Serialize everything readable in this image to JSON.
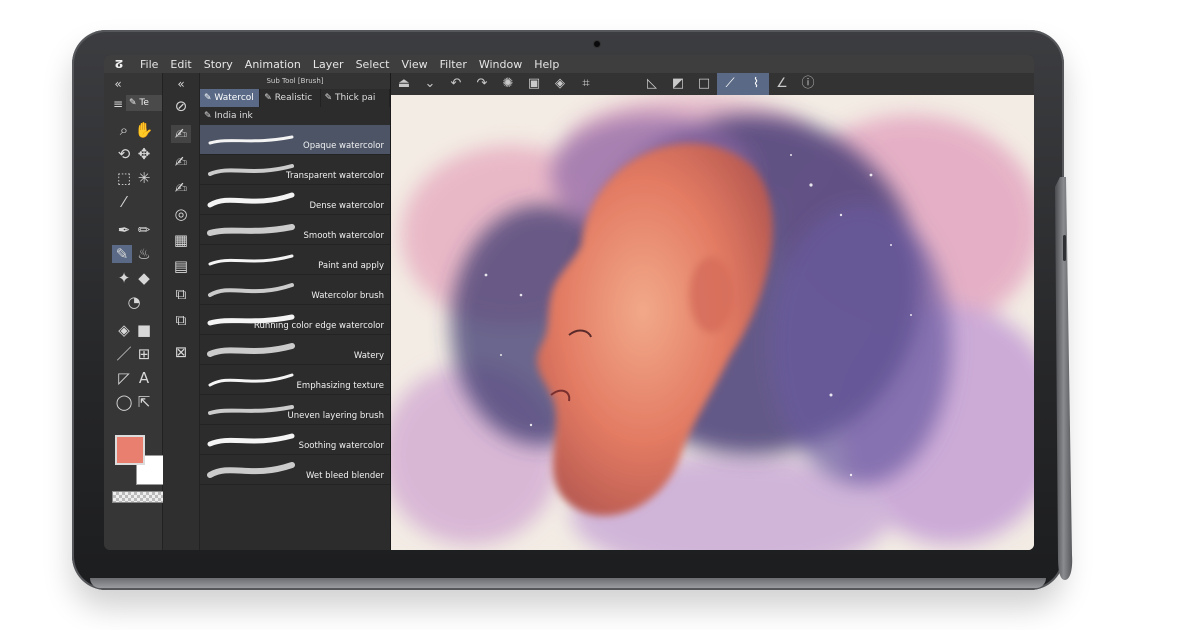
{
  "menu": {
    "logo": "ⵒ",
    "items": [
      "File",
      "Edit",
      "Story",
      "Animation",
      "Layer",
      "Select",
      "View",
      "Filter",
      "Window",
      "Help"
    ]
  },
  "subtool_panel": {
    "title": "Sub Tool [Brush]",
    "tabs": [
      "Watercol",
      "Realistic",
      "Thick pai"
    ],
    "tab_extra": "India ink",
    "left_tab_label": "Te",
    "brushes": [
      {
        "label": "Opaque watercolor",
        "selected": true
      },
      {
        "label": "Transparent watercolor",
        "selected": false
      },
      {
        "label": "Dense watercolor",
        "selected": false
      },
      {
        "label": "Smooth watercolor",
        "selected": false
      },
      {
        "label": "Paint and apply",
        "selected": false
      },
      {
        "label": "Watercolor brush",
        "selected": false
      },
      {
        "label": "Running color edge watercolor",
        "selected": false
      },
      {
        "label": "Watery",
        "selected": false
      },
      {
        "label": "Emphasizing texture",
        "selected": false
      },
      {
        "label": "Uneven layering brush",
        "selected": false
      },
      {
        "label": "Soothing watercolor",
        "selected": false
      },
      {
        "label": "Wet bleed blender",
        "selected": false
      }
    ]
  },
  "colors": {
    "main_color": "#e9806f",
    "sub_color": "#ffffff",
    "accent": "#5a6a86"
  },
  "icons": {
    "tool_column": [
      "zoom-icon",
      "hand-icon",
      "rotate-icon",
      "move-icon",
      "marquee-icon",
      "wand-icon",
      "eyedropper-icon",
      "pen-icon",
      "pencil-icon",
      "brush-icon",
      "airbrush-icon",
      "decoration-icon",
      "eraser-icon",
      "blend-icon",
      "fill-icon",
      "gradient-icon",
      "line-icon",
      "frame-icon",
      "ruler-icon",
      "text-icon",
      "balloon-icon",
      "pointer-icon"
    ],
    "canvas_toolbar": [
      "canvas-settings-icon",
      "chevron-down-icon",
      "undo-icon",
      "redo-icon",
      "loading-icon",
      "transform-icon",
      "fill-icon",
      "crop-icon",
      "select-none-icon",
      "invert-selection-icon",
      "fill-rect-icon",
      "stabilize-icon",
      "pressure-icon",
      "correction-icon",
      "companion-icon"
    ]
  }
}
